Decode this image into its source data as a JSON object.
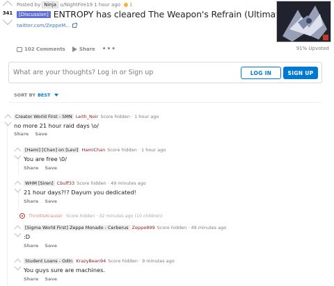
{
  "post": {
    "score": "341",
    "posted_by_prefix": "Posted by",
    "author_flair": "Ninja",
    "author": "u/NightFire19",
    "time": "1 hour ago",
    "award_count": "1",
    "flair": "[Discussion]",
    "title": "ENTROPY has cleared The Weapon's Refrain (Ultimate)!",
    "link_text": "twitter.com/ZeppeM...",
    "comments_label": "102 Comments",
    "share_label": "Share",
    "more_label": "•••",
    "upvoted": "91% Upvoted"
  },
  "login": {
    "prompt": "What are your thoughts? Log in or Sign up",
    "login_button": "LOG IN",
    "signup_button": "SIGN UP"
  },
  "sort": {
    "label": "SORT BY",
    "value": "BEST"
  },
  "comments": [
    {
      "flair": "Creator World First - SMN",
      "user": "Leith_Noir",
      "status": "Score hidden · 1 hour ago",
      "body": "no more 21 hour raid days \\o/",
      "share": "Share",
      "save": "Save"
    },
    {
      "flair": "[Hami] [Chan] on [Levi]",
      "user": "HamiChan",
      "status": "Score hidden · 1 hour ago",
      "body": "You are free \\0/",
      "share": "Share",
      "save": "Save"
    },
    {
      "flair": "WHM [Siren]",
      "user": "Cbuff33",
      "status": "Score hidden · 49 minutes ago",
      "body": "21 hour days?!? Dayum you dedicated!",
      "share": "Share",
      "save": "Save"
    },
    {
      "flair": "[Sigma World First] Zeppe Monado - Cerberus",
      "user": "Zeppe899",
      "status": "Score hidden · 49 minutes ago",
      "body": ":D",
      "share": "Share",
      "save": "Save"
    },
    {
      "flair": "Student Loans - Odin",
      "user": "KrazyBean94",
      "status": "Score hidden · 9 minutes ago",
      "body": "You guys sure are machines.",
      "share": "Share",
      "save": "Save"
    }
  ],
  "collapsed": {
    "user": "ThrottleKrauser",
    "status": "Score hidden · 32 minutes ago (10 children)"
  }
}
